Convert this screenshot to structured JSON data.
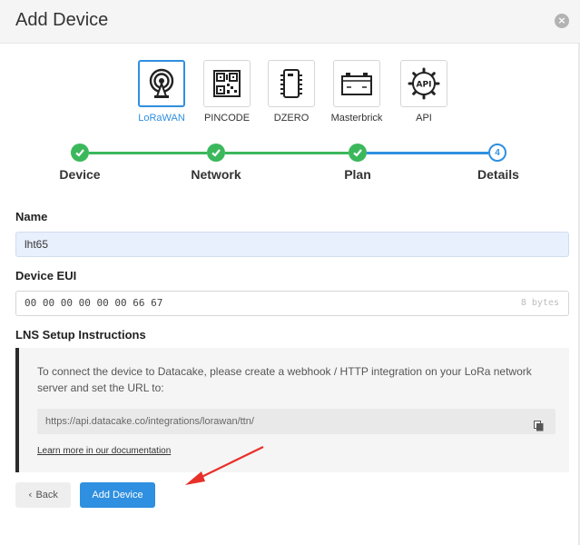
{
  "dialog": {
    "title": "Add Device",
    "close_icon": "close-icon"
  },
  "device_types": [
    {
      "label": "LoRaWAN",
      "icon": "antenna-icon",
      "selected": true
    },
    {
      "label": "PINCODE",
      "icon": "qr-code-icon",
      "selected": false
    },
    {
      "label": "DZERO",
      "icon": "chip-icon",
      "selected": false
    },
    {
      "label": "Masterbrick",
      "icon": "battery-icon",
      "selected": false
    },
    {
      "label": "API",
      "icon": "api-gear-icon",
      "selected": false
    }
  ],
  "steps": [
    {
      "label": "Device",
      "state": "done"
    },
    {
      "label": "Network",
      "state": "done"
    },
    {
      "label": "Plan",
      "state": "done"
    },
    {
      "label": "Details",
      "state": "current",
      "number": "4"
    }
  ],
  "form": {
    "name_label": "Name",
    "name_value": "lht65",
    "eui_label": "Device EUI",
    "eui_value": "00 00 00 00 00 00 66 67",
    "eui_suffix": "8 bytes"
  },
  "lns": {
    "heading": "LNS Setup Instructions",
    "text": "To connect the device to Datacake, please create a webhook / HTTP integration on your LoRa network server and set the URL to:",
    "url": "https://api.datacake.co/integrations/lorawan/ttn/",
    "doc_link": "Learn more in our documentation"
  },
  "buttons": {
    "back": "Back",
    "add": "Add Device"
  },
  "colors": {
    "accent": "#2f8fe0",
    "success": "#3cb85c",
    "annotation_arrow": "#e8302a"
  }
}
